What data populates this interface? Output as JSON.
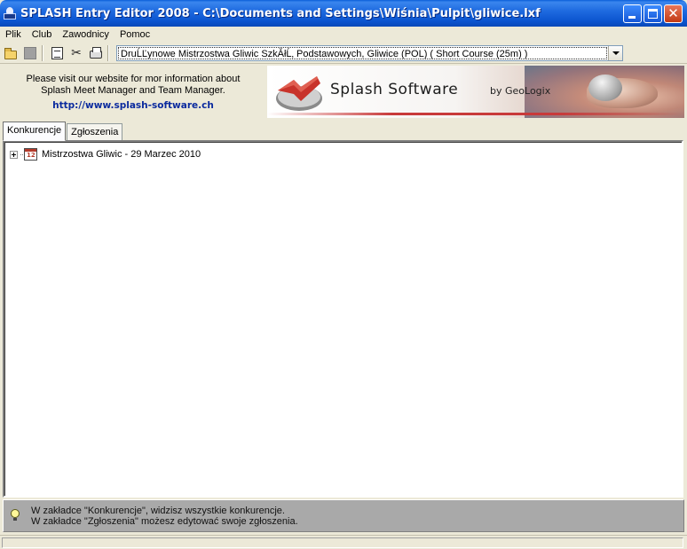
{
  "window": {
    "title": "SPLASH Entry Editor 2008 - C:\\Documents and Settings\\Wiśnia\\Pulpit\\gliwice.lxf",
    "close_glyph": "✕"
  },
  "menu": {
    "items": [
      "Plik",
      "Club",
      "Zawodnicy",
      "Pomoc"
    ]
  },
  "toolbar": {
    "icons": [
      "open-folder-icon",
      "stop-icon",
      "properties-icon",
      "scissors-icon",
      "print-icon"
    ],
    "scissors_glyph": "✂",
    "meet_select_value": "DruĹĽynowe Mistrzostwa Gliwic SzkĂłĹ‚ Podstawowych,  Gliwice  (POL)   ( Short Course (25m) )"
  },
  "info": {
    "text": "Please visit our website for mor information about Splash Meet Manager and Team Manager.",
    "link": "http://www.splash-software.ch"
  },
  "banner": {
    "brand": "Splash Software",
    "by": "by GeoLogix"
  },
  "tabs": [
    {
      "label": "Konkurencje",
      "active": true
    },
    {
      "label": "Zgłoszenia",
      "active": false
    }
  ],
  "tree": {
    "root_label": "Mistrzostwa Gliwic - 29 Marzec 2010",
    "expanded": false
  },
  "hint": {
    "line1": "W zakładce \"Konkurencje\", widzisz wszystkie konkurencje.",
    "line2": "W zakładce \"Zgłoszenia\" możesz edytować swoje zgłoszenia."
  },
  "colors": {
    "titlebar": "#0b54cf",
    "link": "#0a2a9e",
    "hint_bar": "#a9a9a9",
    "banner_accent": "#c83a3a"
  }
}
